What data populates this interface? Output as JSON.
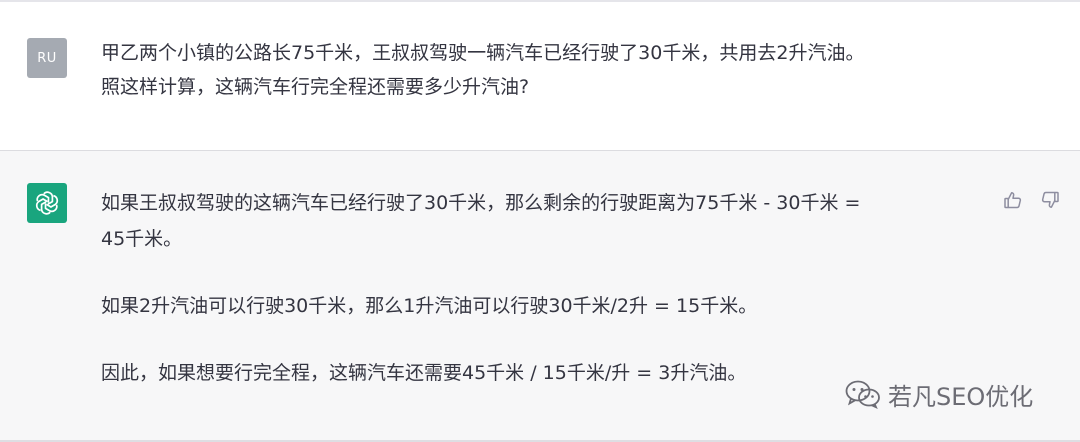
{
  "user": {
    "avatar_initials": "RU",
    "avatar_color": "#a5aab2",
    "message_line1": "甲乙两个小镇的公路长75千米，王叔叔驾驶一辆汽车已经行驶了30千米，共用去2升汽油。",
    "message_line2": "照这样计算，这辆汽车行完全程还需要多少升汽油?"
  },
  "assistant": {
    "avatar_icon": "openai-logo-icon",
    "avatar_color": "#19a57e",
    "paragraph1_line1": "如果王叔叔驾驶的这辆汽车已经行驶了30千米，那么剩余的行驶距离为75千米 - 30千米 =",
    "paragraph1_line2": "45千米。",
    "paragraph2": "如果2升汽油可以行驶30千米，那么1升汽油可以行驶30千米/2升 = 15千米。",
    "paragraph3": "因此，如果想要行完全程，这辆汽车还需要45千米 / 15千米/升 = 3升汽油。",
    "feedback": {
      "thumbs_up_icon": "thumbs-up-icon",
      "thumbs_down_icon": "thumbs-down-icon"
    }
  },
  "watermark": {
    "icon": "wechat-icon",
    "text": "若凡SEO优化"
  }
}
